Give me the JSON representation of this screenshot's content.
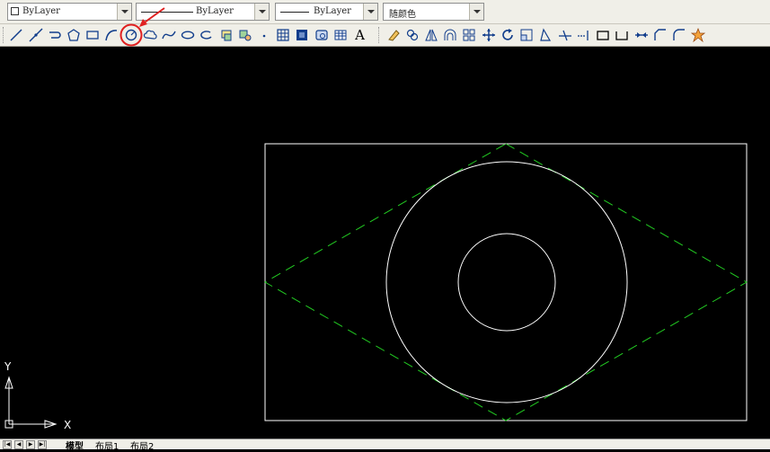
{
  "props_bar": {
    "color": "ByLayer",
    "linetype": "ByLayer",
    "lineweight": "ByLayer",
    "plotstyle": "随颜色"
  },
  "tool_icons": {
    "draw": [
      "line-icon",
      "construction-line-icon",
      "polyline-icon",
      "polygon-icon",
      "rectangle-icon",
      "arc-icon",
      "circle-icon",
      "revision-cloud-icon",
      "spline-icon",
      "ellipse-icon",
      "ellipse-arc-icon",
      "insert-block-icon",
      "make-block-icon",
      "point-icon",
      "hatch-icon",
      "gradient-icon",
      "region-icon",
      "table-icon",
      "multiline-text-icon"
    ],
    "modify": [
      "erase-icon",
      "copy-icon",
      "mirror-icon",
      "offset-icon",
      "array-icon",
      "move-icon",
      "rotate-icon",
      "scale-icon",
      "stretch-icon",
      "trim-icon",
      "extend-icon",
      "break-at-point-icon",
      "break-icon",
      "join-icon",
      "chamfer-icon",
      "fillet-icon",
      "explode-icon"
    ]
  },
  "drawing": {
    "ucs_x_label": "X",
    "ucs_y_label": "Y",
    "highlighted_tool": "circle-icon",
    "colors": {
      "background": "#000000",
      "geometry": "#ffffff",
      "tangent_lines": "#22cc22",
      "annotation": "#e02020"
    }
  },
  "layout_tabs": [
    "模型",
    "布局1",
    "布局2"
  ]
}
